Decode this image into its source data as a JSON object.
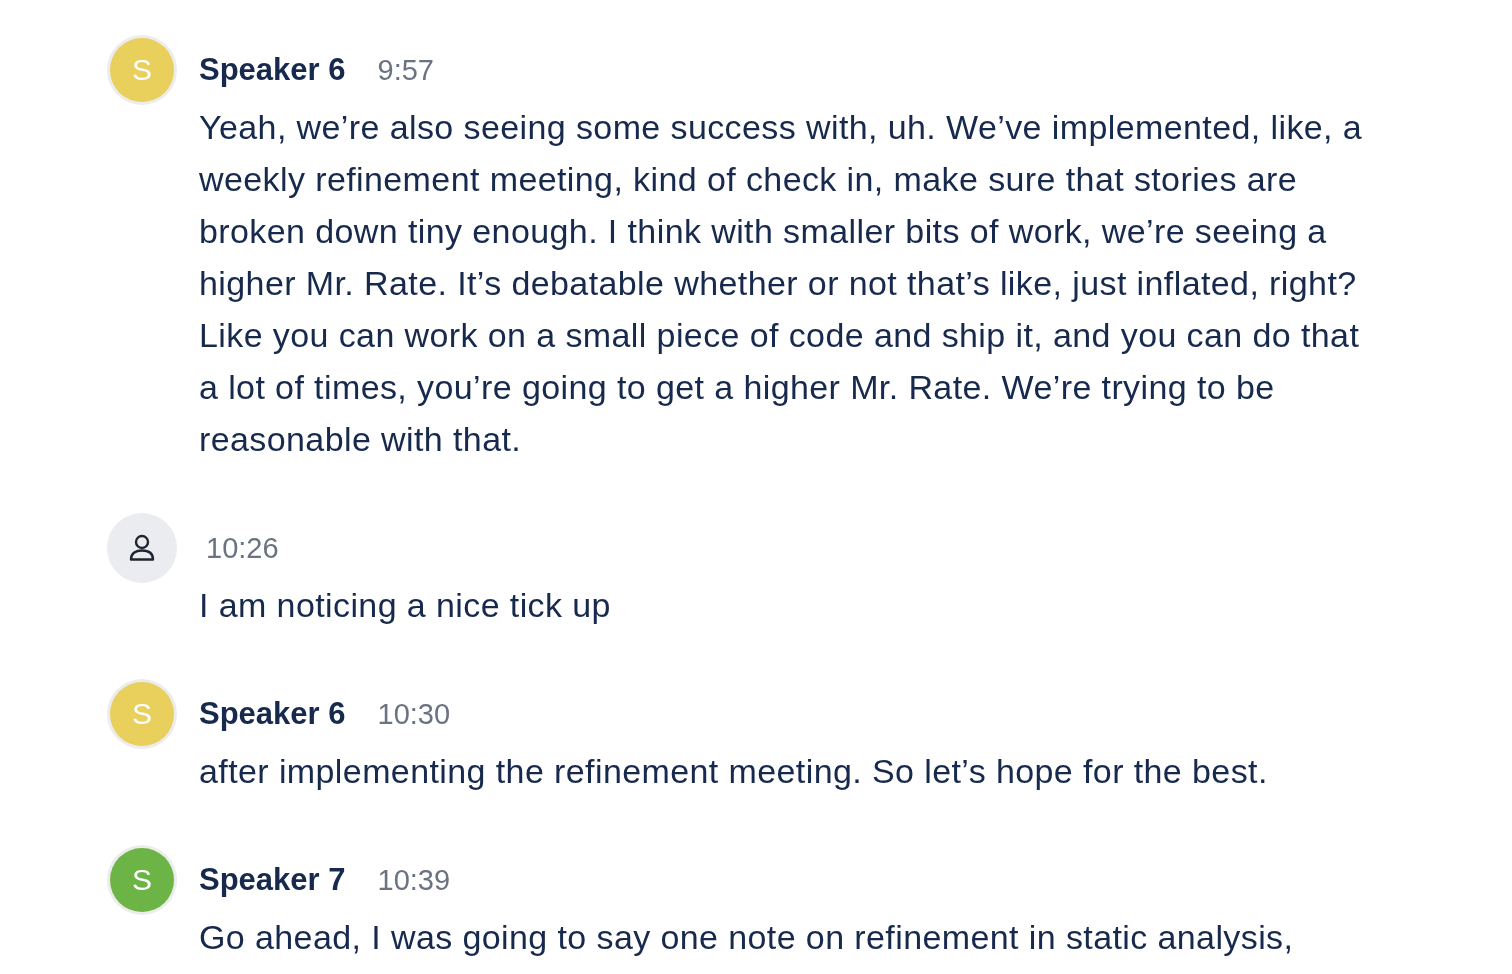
{
  "segments": [
    {
      "speaker": {
        "kind": "initial",
        "initial": "S",
        "color": "#e9cf5b",
        "name": "Speaker 6"
      },
      "time": "9:57",
      "text": "Yeah, we’re also seeing some success with, uh. We’ve implemented, like, a weekly refinement meeting, kind of check in, make sure that stories are broken down tiny enough. I think with smaller bits of work, we’re seeing a higher Mr. Rate. It’s debatable whether or not that’s like, just inflated, right? Like you can work on a small piece of code and ship it, and you can do that a lot of times, you’re going to get a higher Mr. Rate. We’re trying to be reasonable with that."
    },
    {
      "speaker": {
        "kind": "unknown"
      },
      "time": "10:26",
      "text": "I am noticing a nice tick up"
    },
    {
      "speaker": {
        "kind": "initial",
        "initial": "S",
        "color": "#e9cf5b",
        "name": "Speaker 6"
      },
      "time": "10:30",
      "text": "after implementing the refinement meeting. So let’s hope for the best."
    },
    {
      "speaker": {
        "kind": "initial",
        "initial": "S",
        "color": "#6db446",
        "name": "Speaker 7"
      },
      "time": "10:39",
      "text": "Go ahead, I was going to say one note on refinement in static analysis,"
    }
  ]
}
